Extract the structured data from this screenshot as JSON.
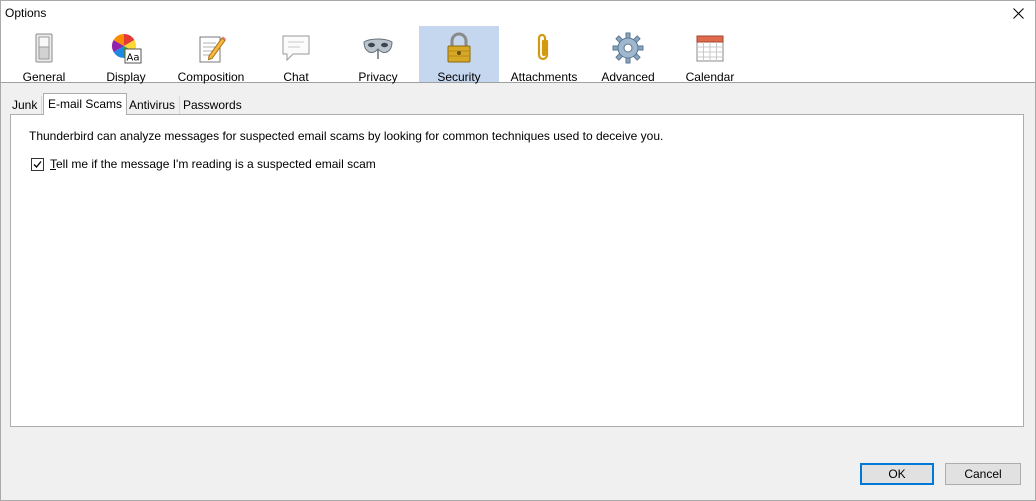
{
  "window": {
    "title": "Options"
  },
  "toolbar": {
    "panes": [
      {
        "label": "General",
        "icon": "switch-icon"
      },
      {
        "label": "Display",
        "icon": "color-wheel-font-icon"
      },
      {
        "label": "Composition",
        "icon": "pencil-paper-icon"
      },
      {
        "label": "Chat",
        "icon": "speech-bubble-icon"
      },
      {
        "label": "Privacy",
        "icon": "mask-icon"
      },
      {
        "label": "Security",
        "icon": "padlock-icon",
        "selected": true
      },
      {
        "label": "Attachments",
        "icon": "paperclip-icon"
      },
      {
        "label": "Advanced",
        "icon": "gear-icon"
      },
      {
        "label": "Calendar",
        "icon": "calendar-icon"
      }
    ]
  },
  "tabs": [
    {
      "label": "Junk",
      "active": false
    },
    {
      "label": "E-mail Scams",
      "active": true
    },
    {
      "label": "Antivirus",
      "active": false
    },
    {
      "label": "Passwords",
      "active": false
    }
  ],
  "panel": {
    "description": "Thunderbird can analyze messages for suspected email scams by looking for common techniques used to deceive you.",
    "checkbox": {
      "accesskey": "T",
      "label_rest": "ell me if the message I'm reading is a suspected email scam",
      "checked": true
    }
  },
  "buttons": {
    "ok": "OK",
    "cancel": "Cancel"
  },
  "colors": {
    "selected_pane": "#c5d7ef",
    "default_button_border": "#0078d7"
  }
}
